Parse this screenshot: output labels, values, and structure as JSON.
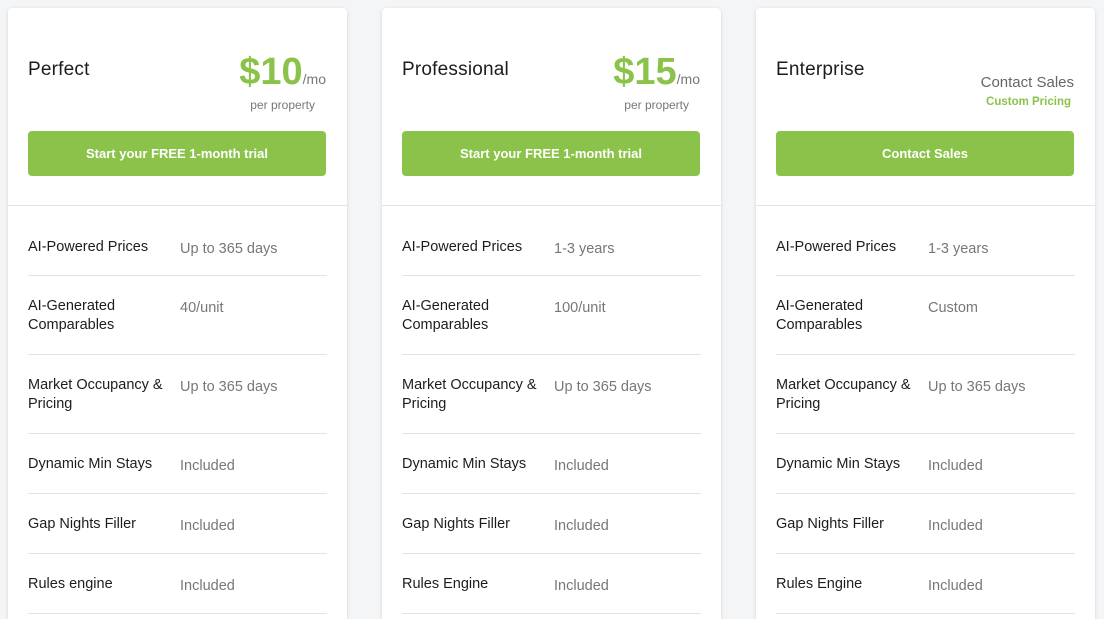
{
  "plans": [
    {
      "name": "Perfect",
      "price": "$10",
      "per": "/mo",
      "sub": "per property",
      "cta": "Start your FREE 1-month trial",
      "features": [
        {
          "label": "AI-Powered Prices",
          "value": "Up to 365 days"
        },
        {
          "label": "AI-Generated Comparables",
          "value": "40/unit"
        },
        {
          "label": "Market Occupancy & Pricing",
          "value": "Up to 365 days"
        },
        {
          "label": "Dynamic Min Stays",
          "value": "Included"
        },
        {
          "label": "Gap Nights Filler",
          "value": "Included"
        },
        {
          "label": "Rules engine",
          "value": "Included"
        }
      ]
    },
    {
      "name": "Professional",
      "price": "$15",
      "per": "/mo",
      "sub": "per property",
      "cta": "Start your FREE 1-month trial",
      "features": [
        {
          "label": "AI-Powered Prices",
          "value": "1-3 years"
        },
        {
          "label": "AI-Generated Comparables",
          "value": "100/unit"
        },
        {
          "label": "Market Occupancy & Pricing",
          "value": "Up to 365 days"
        },
        {
          "label": "Dynamic Min Stays",
          "value": "Included"
        },
        {
          "label": "Gap Nights Filler",
          "value": "Included"
        },
        {
          "label": "Rules Engine",
          "value": "Included"
        }
      ]
    },
    {
      "name": "Enterprise",
      "contact": "Contact Sales",
      "custom": "Custom Pricing",
      "cta": "Contact Sales",
      "features": [
        {
          "label": "AI-Powered Prices",
          "value": "1-3 years"
        },
        {
          "label": "AI-Generated Comparables",
          "value": "Custom"
        },
        {
          "label": "Market Occupancy & Pricing",
          "value": "Up to 365 days"
        },
        {
          "label": "Dynamic Min Stays",
          "value": "Included"
        },
        {
          "label": "Gap Nights Filler",
          "value": "Included"
        },
        {
          "label": "Rules Engine",
          "value": "Included"
        }
      ]
    }
  ],
  "colors": {
    "accent": "#8bc34a",
    "text": "#1d1d1d",
    "muted": "#777777",
    "divider": "#e3e3e3"
  }
}
